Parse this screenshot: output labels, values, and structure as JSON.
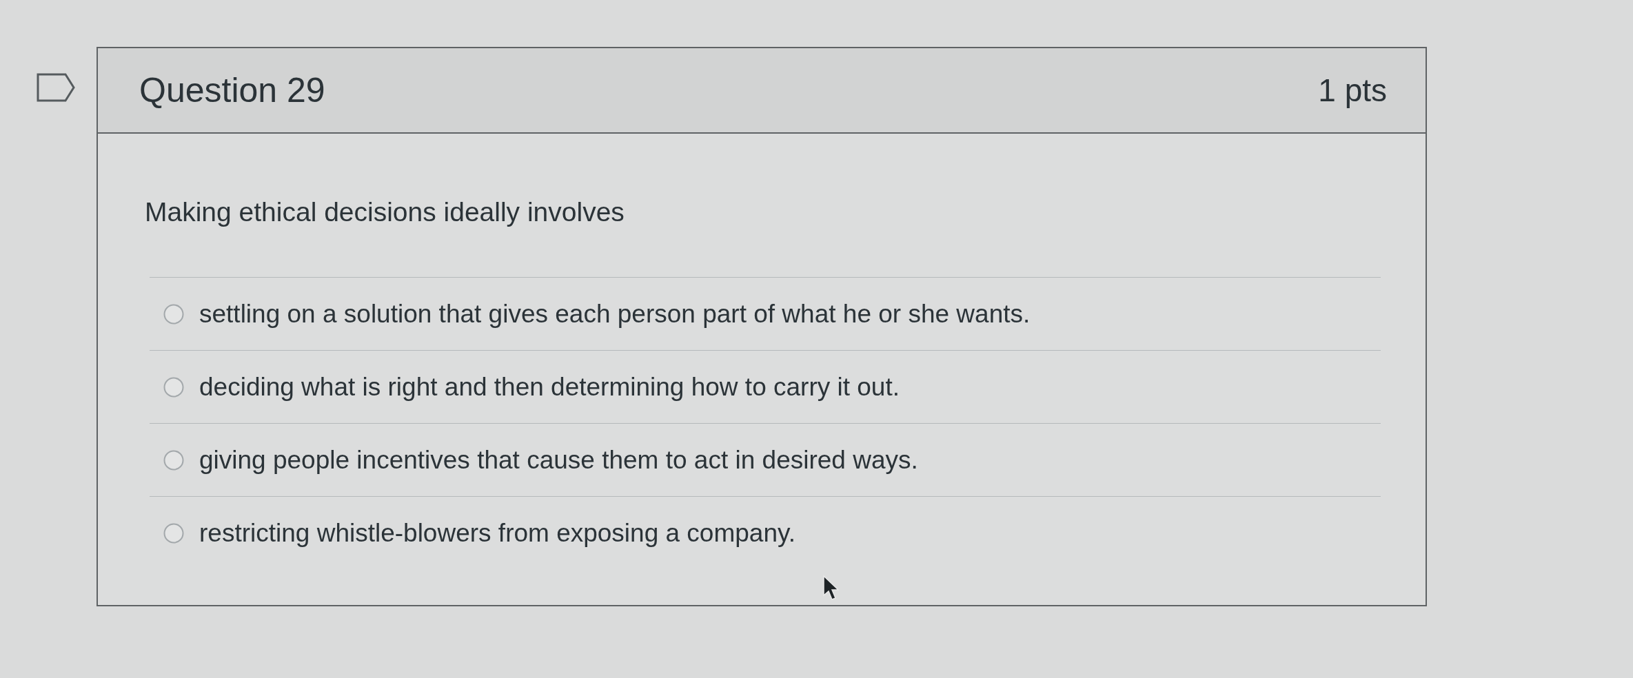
{
  "question": {
    "flagged": false,
    "title": "Question 29",
    "points": "1 pts",
    "text": "Making ethical decisions ideally involves",
    "answers": [
      {
        "label": "settling on a solution that gives each person part of what he or she wants.",
        "selected": false
      },
      {
        "label": "deciding what is right and then determining how to carry it out.",
        "selected": false
      },
      {
        "label": "giving people incentives that cause them to act in desired ways.",
        "selected": false
      },
      {
        "label": "restricting whistle-blowers from exposing a company.",
        "selected": false
      }
    ]
  }
}
